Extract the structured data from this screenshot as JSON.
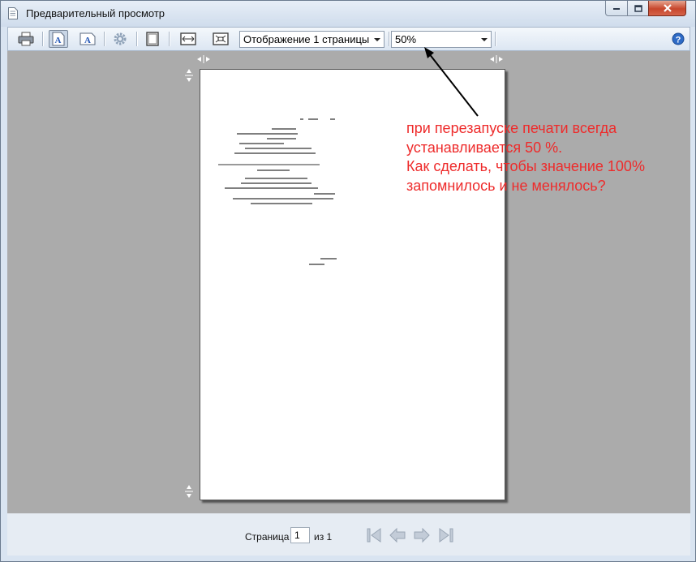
{
  "window": {
    "title": "Предварительный просмотр"
  },
  "toolbar": {
    "icons": [
      "print-icon",
      "text-a-blue-icon",
      "text-a-icon",
      "settings-gear-icon",
      "page-fit-icon",
      "fit-width-icon",
      "fit-page-icon",
      "help-icon"
    ],
    "pages_mode": "Отображение 1 страницы",
    "zoom": "50%"
  },
  "annotation": {
    "lines": [
      "при перезапуске печати всегда",
      "устанавливается 50 %.",
      "Как сделать, чтобы значение 100%",
      "запомнилось и не менялось?"
    ],
    "color": "#ee2b2b"
  },
  "pager": {
    "page_label": "Страница",
    "page_value": "1",
    "of_label": "из 1"
  }
}
